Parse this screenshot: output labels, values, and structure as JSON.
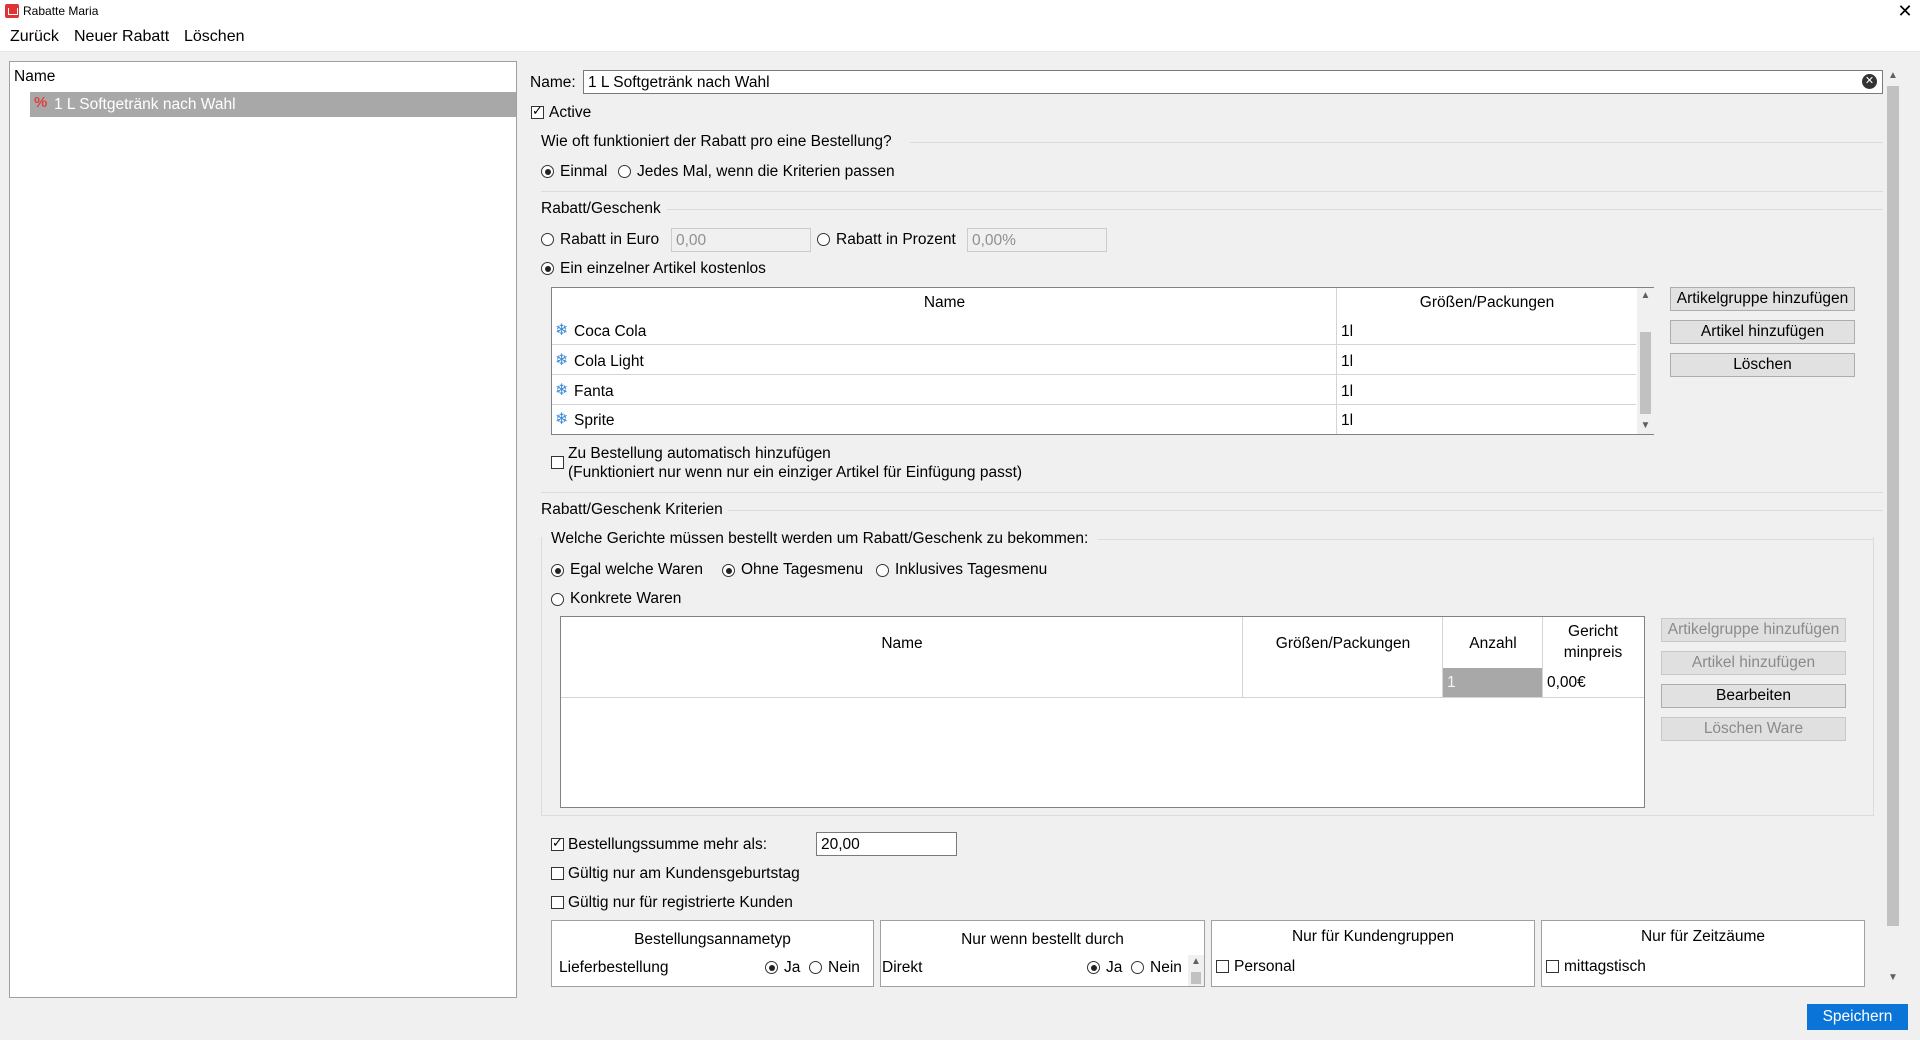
{
  "window": {
    "title": "Rabatte Maria"
  },
  "menu": {
    "back": "Zurück",
    "new": "Neuer Rabatt",
    "delete": "Löschen"
  },
  "left_list": {
    "header": "Name",
    "items": [
      {
        "label": "1 L Softgetränk nach Wahl",
        "icon": "percent-icon"
      }
    ]
  },
  "form": {
    "name_label": "Name:",
    "name_value": "1 L Softgetränk nach Wahl",
    "active_label": "Active",
    "active_checked": true,
    "frequency": {
      "title": "Wie oft funktioniert der Rabatt pro eine Bestellung?",
      "once": "Einmal",
      "every": "Jedes Mal, wenn die Kriterien passen",
      "selected": "once"
    },
    "discount": {
      "title": "Rabatt/Geschenk",
      "euro_label": "Rabatt in Euro",
      "euro_value": "0,00",
      "percent_label": "Rabatt in Prozent",
      "percent_value": "0,00%",
      "free_item_label": "Ein einzelner Artikel kostenlos",
      "selected": "free_item",
      "table_headers": {
        "name": "Name",
        "size": "Größen/Packungen"
      },
      "items": [
        {
          "name": "Coca Cola",
          "size": "1l"
        },
        {
          "name": "Cola Light",
          "size": "1l"
        },
        {
          "name": "Fanta",
          "size": "1l"
        },
        {
          "name": "Sprite",
          "size": "1l"
        }
      ],
      "btn_add_group": "Artikelgruppe hinzufügen",
      "btn_add_item": "Artikel hinzufügen",
      "btn_delete": "Löschen",
      "auto_add_line1": "Zu Bestellung automatisch hinzufügen",
      "auto_add_line2": "(Funktioniert nur wenn nur ein einziger Artikel für Einfügung passt)"
    },
    "criteria": {
      "title": "Rabatt/Geschenk Kriterien",
      "sub_title": "Welche Gerichte müssen bestellt werden um Rabatt/Geschenk zu bekommen:",
      "any_goods": "Egal welche Waren",
      "no_daily_menu": "Ohne Tagesmenu",
      "incl_daily_menu": "Inklusives Tagesmenu",
      "specific_goods": "Konkrete Waren",
      "table_headers": {
        "name": "Name",
        "size": "Größen/Packungen",
        "count": "Anzahl",
        "minprice_1": "Gericht",
        "minprice_2": "minpreis"
      },
      "row": {
        "count": "1",
        "minprice": "0,00€"
      },
      "btn_add_group": "Artikelgruppe hinzufügen",
      "btn_add_item": "Artikel hinzufügen",
      "btn_edit": "Bearbeiten",
      "btn_delete_goods": "Löschen Ware",
      "order_sum_label": "Bestellungssumme mehr als:",
      "order_sum_value": "20,00",
      "birthday_label": "Gültig nur am Kundensgeburtstag",
      "registered_label": "Gültig nur für registrierte Kunden"
    },
    "panels": {
      "order_type": {
        "title": "Bestellungsannametyp",
        "row_label": "Lieferbestellung",
        "yes": "Ja",
        "no": "Nein"
      },
      "ordered_by": {
        "title": "Nur wenn bestellt durch",
        "row_label": "Direkt",
        "yes": "Ja",
        "no": "Nein"
      },
      "customer_groups": {
        "title": "Nur für Kundengruppen",
        "item": "Personal"
      },
      "time_ranges": {
        "title": "Nur für Zeitzäume",
        "item": "mittagstisch"
      }
    },
    "save": "Speichern"
  }
}
